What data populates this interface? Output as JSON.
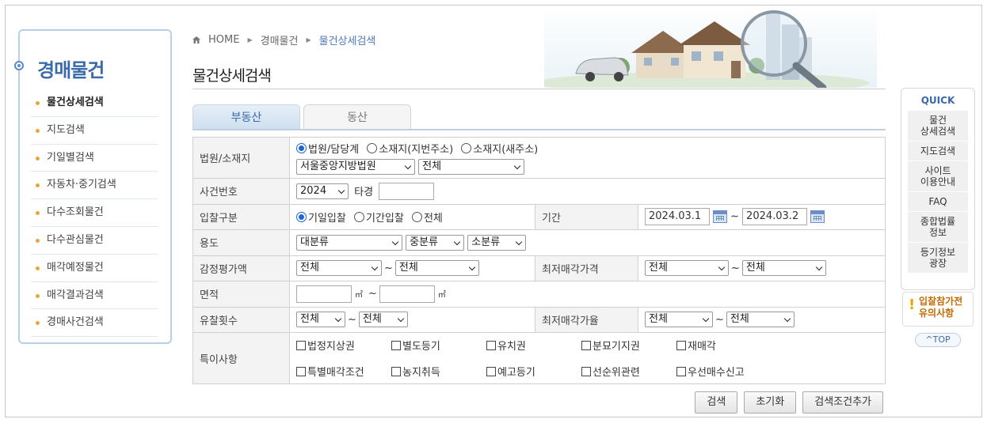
{
  "leftnav": {
    "title": "경매물건",
    "items": [
      {
        "label": "물건상세검색"
      },
      {
        "label": "지도검색"
      },
      {
        "label": "기일별검색"
      },
      {
        "label": "자동차·중기검색"
      },
      {
        "label": "다수조회물건"
      },
      {
        "label": "다수관심물건"
      },
      {
        "label": "매각예정물건"
      },
      {
        "label": "매각결과검색"
      },
      {
        "label": "경매사건검색"
      }
    ]
  },
  "breadcrumb": {
    "home": "HOME",
    "level1": "경매물건",
    "current": "물건상세검색"
  },
  "page_title": "물건상세검색",
  "tabs": {
    "real_estate": "부동산",
    "movable": "동산"
  },
  "form": {
    "court": {
      "label": "법원/소재지",
      "opt_court": "법원/담당계",
      "opt_lot": "소재지(지번주소)",
      "opt_new": "소재지(새주소)",
      "court_select": "서울중앙지방법원",
      "dept_select": "전체"
    },
    "case": {
      "label": "사건번호",
      "year": "2024",
      "type_label": "타경",
      "number": ""
    },
    "bid": {
      "label": "입찰구분",
      "opt1": "기일입찰",
      "opt2": "기간입찰",
      "opt3": "전체",
      "period_label": "기간",
      "from": "2024.03.1",
      "tilde": "~",
      "to": "2024.03.2"
    },
    "usage": {
      "label": "용도",
      "major": "대분류",
      "middle": "중분류",
      "minor": "소분류"
    },
    "appraisal": {
      "label": "감정평가액",
      "from": "전체",
      "to": "전체",
      "min_label": "최저매각가격",
      "min_from": "전체",
      "min_to": "전체"
    },
    "area": {
      "label": "면적",
      "unit": "㎡"
    },
    "fail": {
      "label": "유찰횟수",
      "from": "전체",
      "to": "전체",
      "rate_label": "최저매각가율",
      "rate_from": "전체",
      "rate_to": "전체"
    },
    "special": {
      "label": "특이사항",
      "items": [
        "법정지상권",
        "별도등기",
        "유치권",
        "분묘기지권",
        "재매각",
        "특별매각조건",
        "농지취득",
        "예고등기",
        "선순위관련",
        "우선매수신고"
      ]
    }
  },
  "buttons": {
    "search": "검색",
    "reset": "초기화",
    "add": "검색조건추가"
  },
  "quick": {
    "title": "QUICK",
    "items": [
      "물건\n상세검색",
      "지도검색",
      "사이트\n이용안내",
      "FAQ",
      "종합법률\n정보",
      "등기정보\n광장"
    ]
  },
  "notice": {
    "line1": "입찰참가전",
    "line2": "유의사항"
  },
  "top_button": "TOP"
}
